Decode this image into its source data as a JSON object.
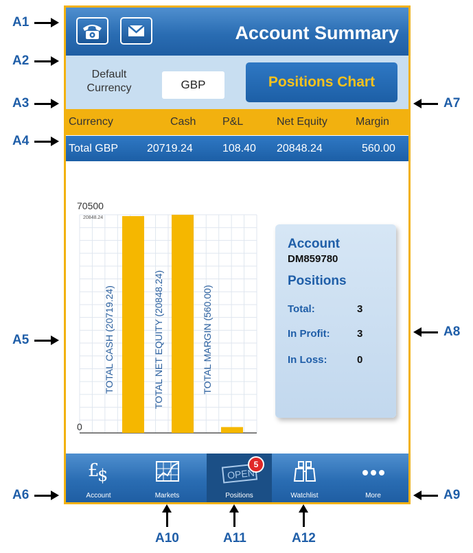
{
  "callouts": {
    "a1": "A1",
    "a2": "A2",
    "a3": "A3",
    "a4": "A4",
    "a5": "A5",
    "a6": "A6",
    "a7": "A7",
    "a8": "A8",
    "a9": "A9",
    "a10": "A10",
    "a11": "A11",
    "a12": "A12"
  },
  "header": {
    "title": "Account Summary",
    "phone_icon": "phone-icon",
    "mail_icon": "envelope-icon",
    "color": "#2a6db3"
  },
  "currency_row": {
    "label_line1": "Default",
    "label_line2": "Currency",
    "currency_value": "GBP",
    "positions_chart_button": "Positions Chart"
  },
  "summary_table": {
    "columns": [
      "Currency",
      "Cash",
      "P&L",
      "Net Equity",
      "Margin"
    ],
    "total_row": [
      "Total GBP",
      "20719.24",
      "108.40",
      "20848.24",
      "560.00"
    ],
    "header_color": "#f2b10f"
  },
  "chart_data": {
    "type": "bar",
    "categories": [
      "TOTAL CASH (20719.24)",
      "TOTAL NET EQUITY (20848.24)",
      "TOTAL MARGIN (560.00)"
    ],
    "values": [
      20719.24,
      20848.24,
      560.0
    ],
    "ylim": [
      0,
      70500
    ],
    "y_tick_labels": [
      "70500",
      "0"
    ],
    "top_label": "20848.24",
    "bar_color": "#f5b700",
    "grid": true
  },
  "account_panel": {
    "title": "Account",
    "account_number": "DM859780",
    "positions_heading": "Positions",
    "stats": [
      {
        "label": "Total:",
        "value": "3"
      },
      {
        "label": "In Profit:",
        "value": "3"
      },
      {
        "label": "In Loss:",
        "value": "0"
      }
    ]
  },
  "tab_bar": {
    "tabs": [
      {
        "label": "Account",
        "icon": "currency-icon"
      },
      {
        "label": "Markets",
        "icon": "chart-icon"
      },
      {
        "label": "Positions",
        "icon": "open-sign-icon",
        "badge": "5",
        "badge_sign": "OPEN",
        "selected": true
      },
      {
        "label": "Watchlist",
        "icon": "binoculars-icon"
      },
      {
        "label": "More",
        "icon": "more-icon"
      }
    ]
  }
}
